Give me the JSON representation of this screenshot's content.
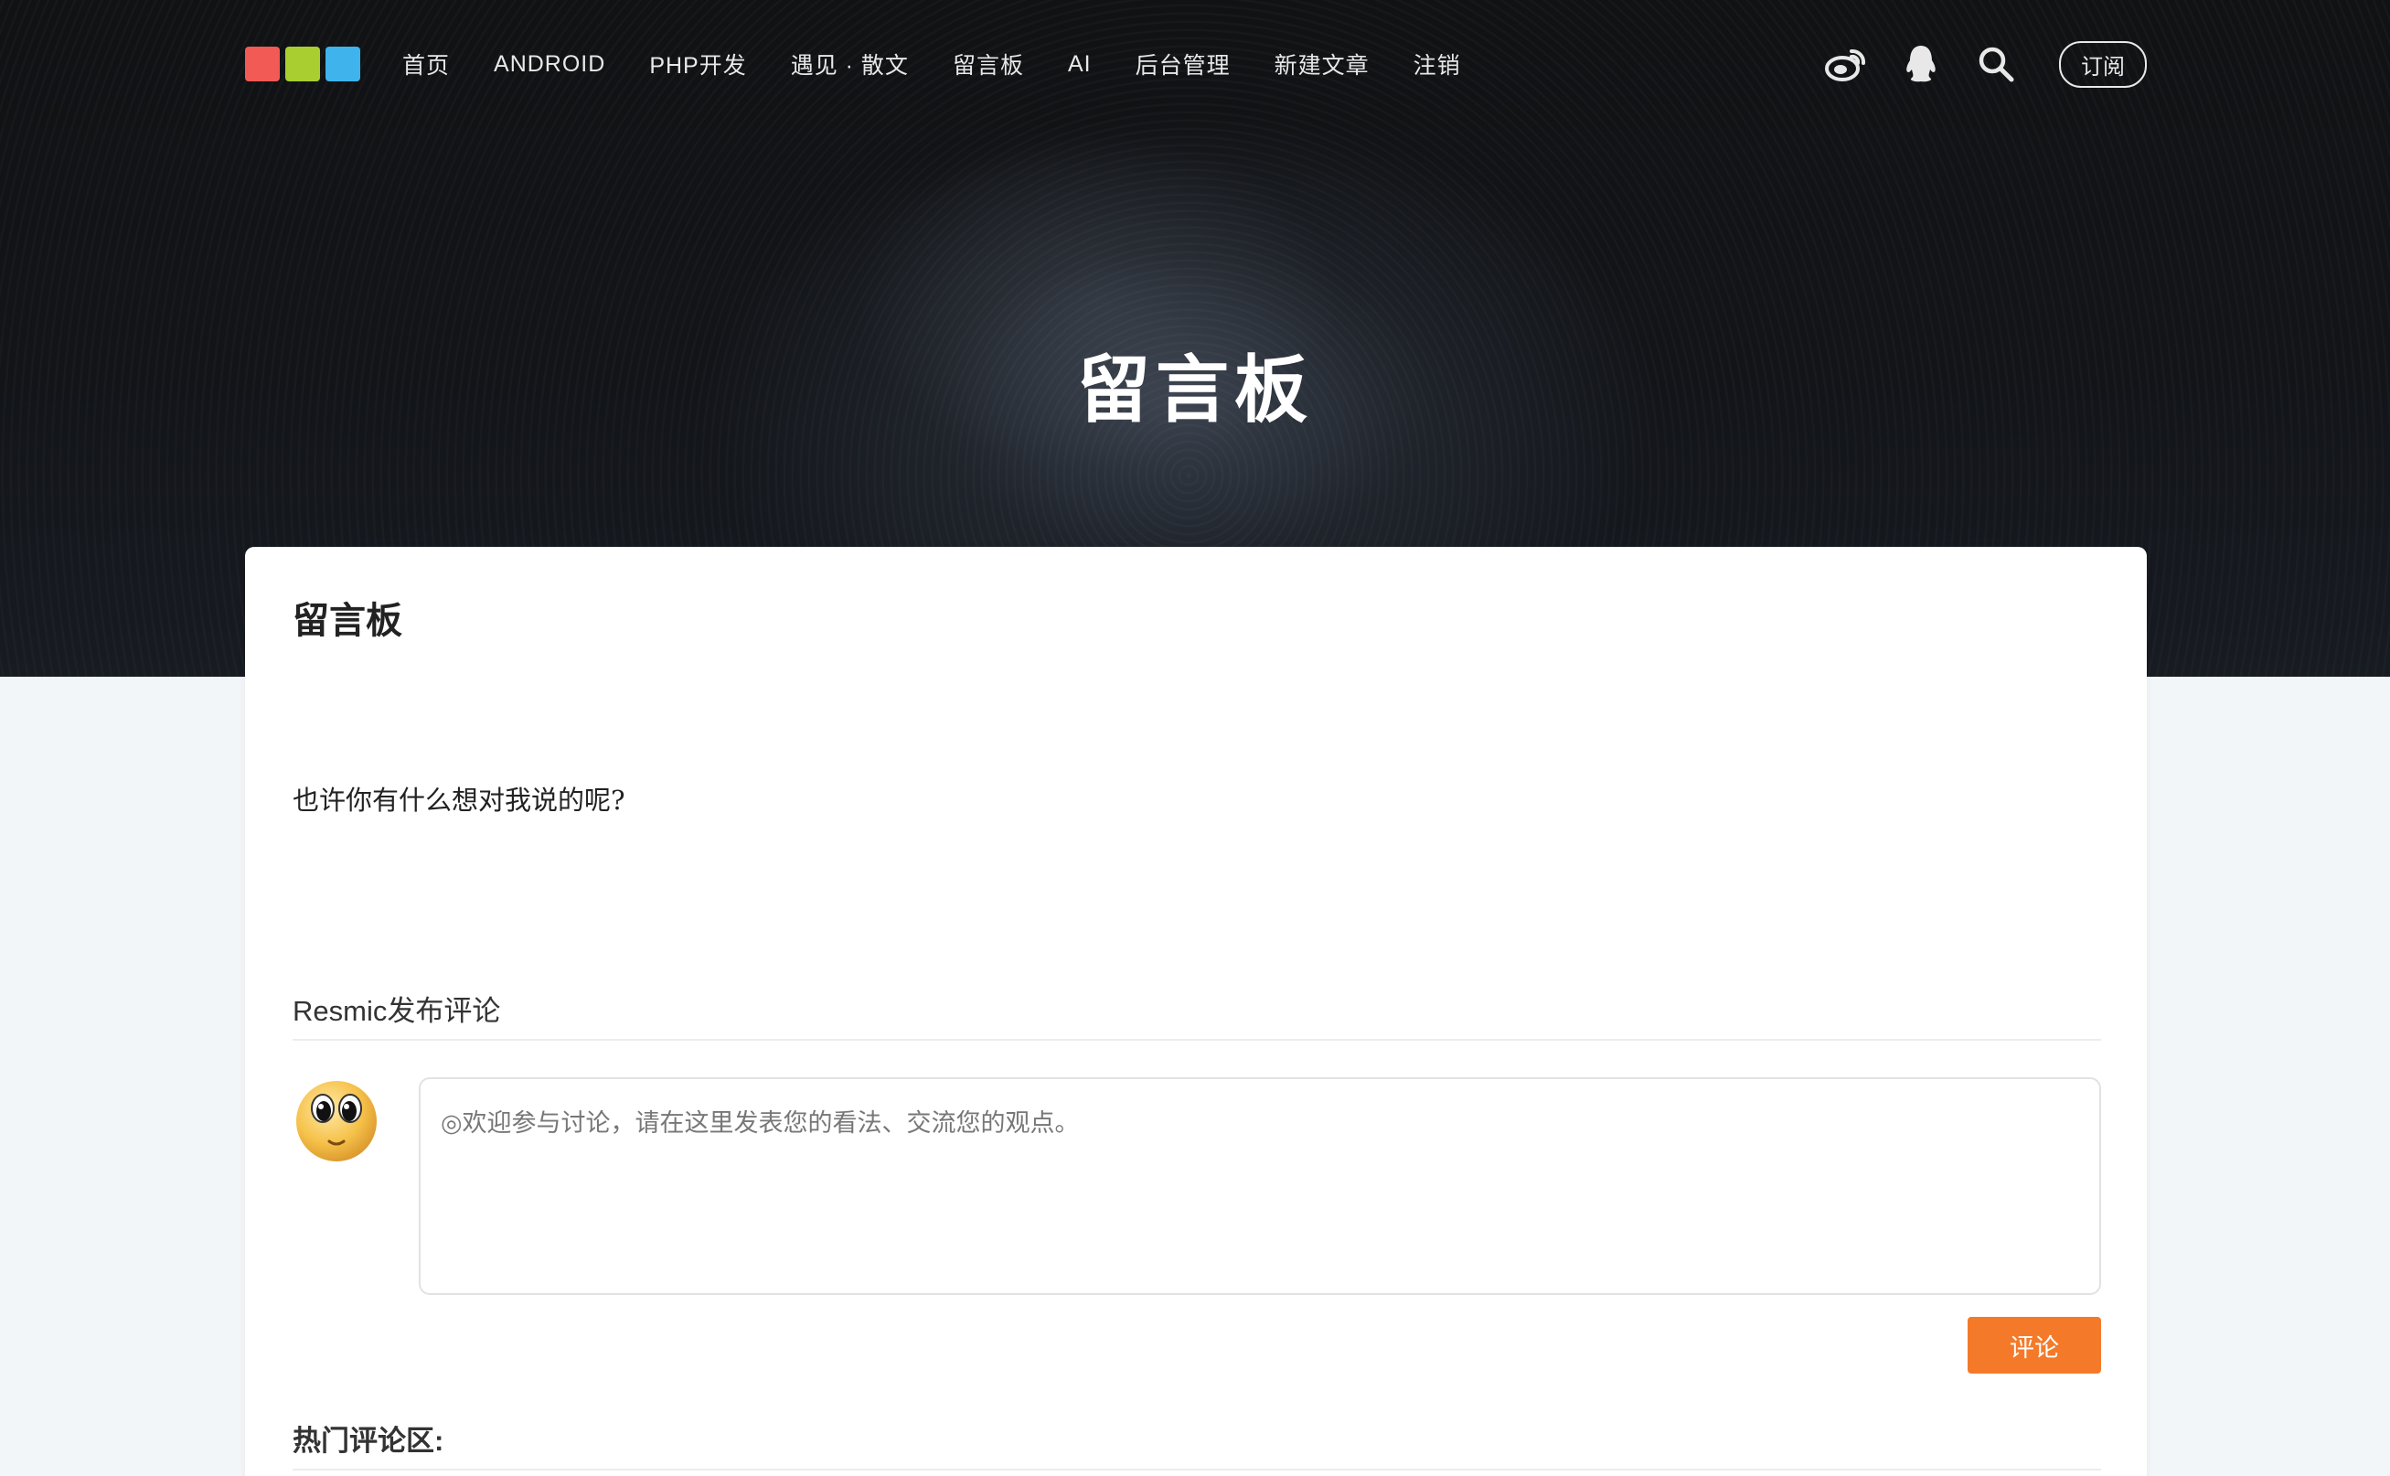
{
  "nav": {
    "logo_colors": [
      "#f25a55",
      "#a8cf2f",
      "#3fb4ec"
    ],
    "items": [
      {
        "label": "首页"
      },
      {
        "label": "ANDROID"
      },
      {
        "label": "PHP开发"
      },
      {
        "label": "遇见 · 散文"
      },
      {
        "label": "留言板"
      },
      {
        "label": "AI"
      },
      {
        "label": "后台管理"
      },
      {
        "label": "新建文章"
      },
      {
        "label": "注销"
      }
    ],
    "icons": [
      "weibo-icon",
      "qq-icon",
      "search-icon"
    ],
    "subscribe_label": "订阅"
  },
  "hero": {
    "title": "留言板"
  },
  "page": {
    "title": "留言板",
    "intro": "也许你有什么想对我说的呢?"
  },
  "comment": {
    "heading": "Resmic发布评论",
    "placeholder": "◎欢迎参与讨论，请在这里发表您的看法、交流您的观点。",
    "submit_label": "评论",
    "accent_color": "#f47a2a"
  },
  "hot": {
    "heading": "热门评论区:"
  }
}
